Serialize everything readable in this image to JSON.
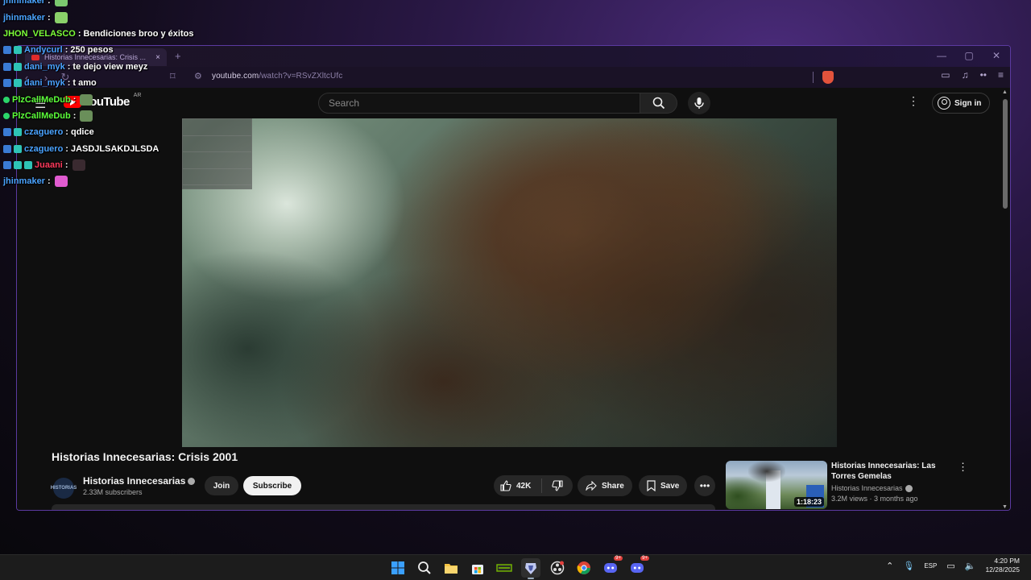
{
  "chat": {
    "messages": [
      {
        "user": "jhinmaker",
        "color": "#4aa3ff",
        "text": "",
        "badges": [],
        "emote": "#7bc96f"
      },
      {
        "user": "jhinmaker",
        "color": "#4aa3ff",
        "text": "",
        "badges": [],
        "emote": "#8ad06a"
      },
      {
        "user": "JHON_VELASCO",
        "color": "#7dff3a",
        "text": "Bendiciones broo y éxitos",
        "badges": [],
        "emote": ""
      },
      {
        "user": "Andycurl",
        "color": "#4aa3ff",
        "text": "250 pesos",
        "badges": [
          "b1",
          "b2"
        ],
        "emote": ""
      },
      {
        "user": "dani_myk",
        "color": "#4aa3ff",
        "text": "te dejo view meyz",
        "badges": [
          "b1",
          "b2"
        ],
        "emote": ""
      },
      {
        "user": "dani_myk",
        "color": "#4aa3ff",
        "text": "t amo",
        "badges": [
          "b1",
          "b2"
        ],
        "emote": ""
      },
      {
        "user": "PlzCallMeDub",
        "color": "#5cff3a",
        "text": "",
        "badges": [
          "b3"
        ],
        "emote": "#6a8f5a"
      },
      {
        "user": "PlzCallMeDub",
        "color": "#5cff3a",
        "text": "",
        "badges": [
          "b3"
        ],
        "emote": "#6a8f5a"
      },
      {
        "user": "czaguero",
        "color": "#4aa3ff",
        "text": "qdice",
        "badges": [
          "b1",
          "b2"
        ],
        "emote": ""
      },
      {
        "user": "czaguero",
        "color": "#4aa3ff",
        "text": "JASDJLSAKDJLSDA",
        "badges": [
          "b1",
          "b2"
        ],
        "emote": ""
      },
      {
        "user": "Juaani",
        "color": "#ff3a5c",
        "text": "",
        "badges": [
          "b1",
          "b2",
          "b2"
        ],
        "emote": "#3a2a30"
      },
      {
        "user": "jhinmaker",
        "color": "#4aa3ff",
        "text": "",
        "badges": [],
        "emote": "#e05bd0"
      }
    ]
  },
  "browser": {
    "tab_title": "Historias Innecesarias: Crisis ...",
    "tab_close": "×",
    "new_tab": "+",
    "url_domain": "youtube.com",
    "url_path": "/watch?v=RSvZXltcUfc",
    "window_min": "—",
    "window_max": "▢",
    "window_close": "✕"
  },
  "youtube": {
    "logo_text": "YouTube",
    "country": "AR",
    "search_placeholder": "Search",
    "sign_in": "Sign in",
    "video_title": "Historias Innecesarias: Crisis 2001",
    "channel_name": "Historias Innecesarias",
    "channel_logo_text": "HISTORIAS",
    "subscribers": "2.33M subscribers",
    "join": "Join",
    "subscribe": "Subscribe",
    "likes": "42K",
    "share": "Share",
    "save": "Save",
    "recommended": {
      "title": "Historias Innecesarias: Las Torres Gemelas",
      "channel": "Historias Innecesarias",
      "meta": "3.2M views · 3 months ago",
      "duration": "1:18:23"
    }
  },
  "taskbar": {
    "language": "ESP",
    "time": "4:20 PM",
    "date": "12/28/2025",
    "notif_discord_1": "9+",
    "notif_discord_2": "9+"
  }
}
